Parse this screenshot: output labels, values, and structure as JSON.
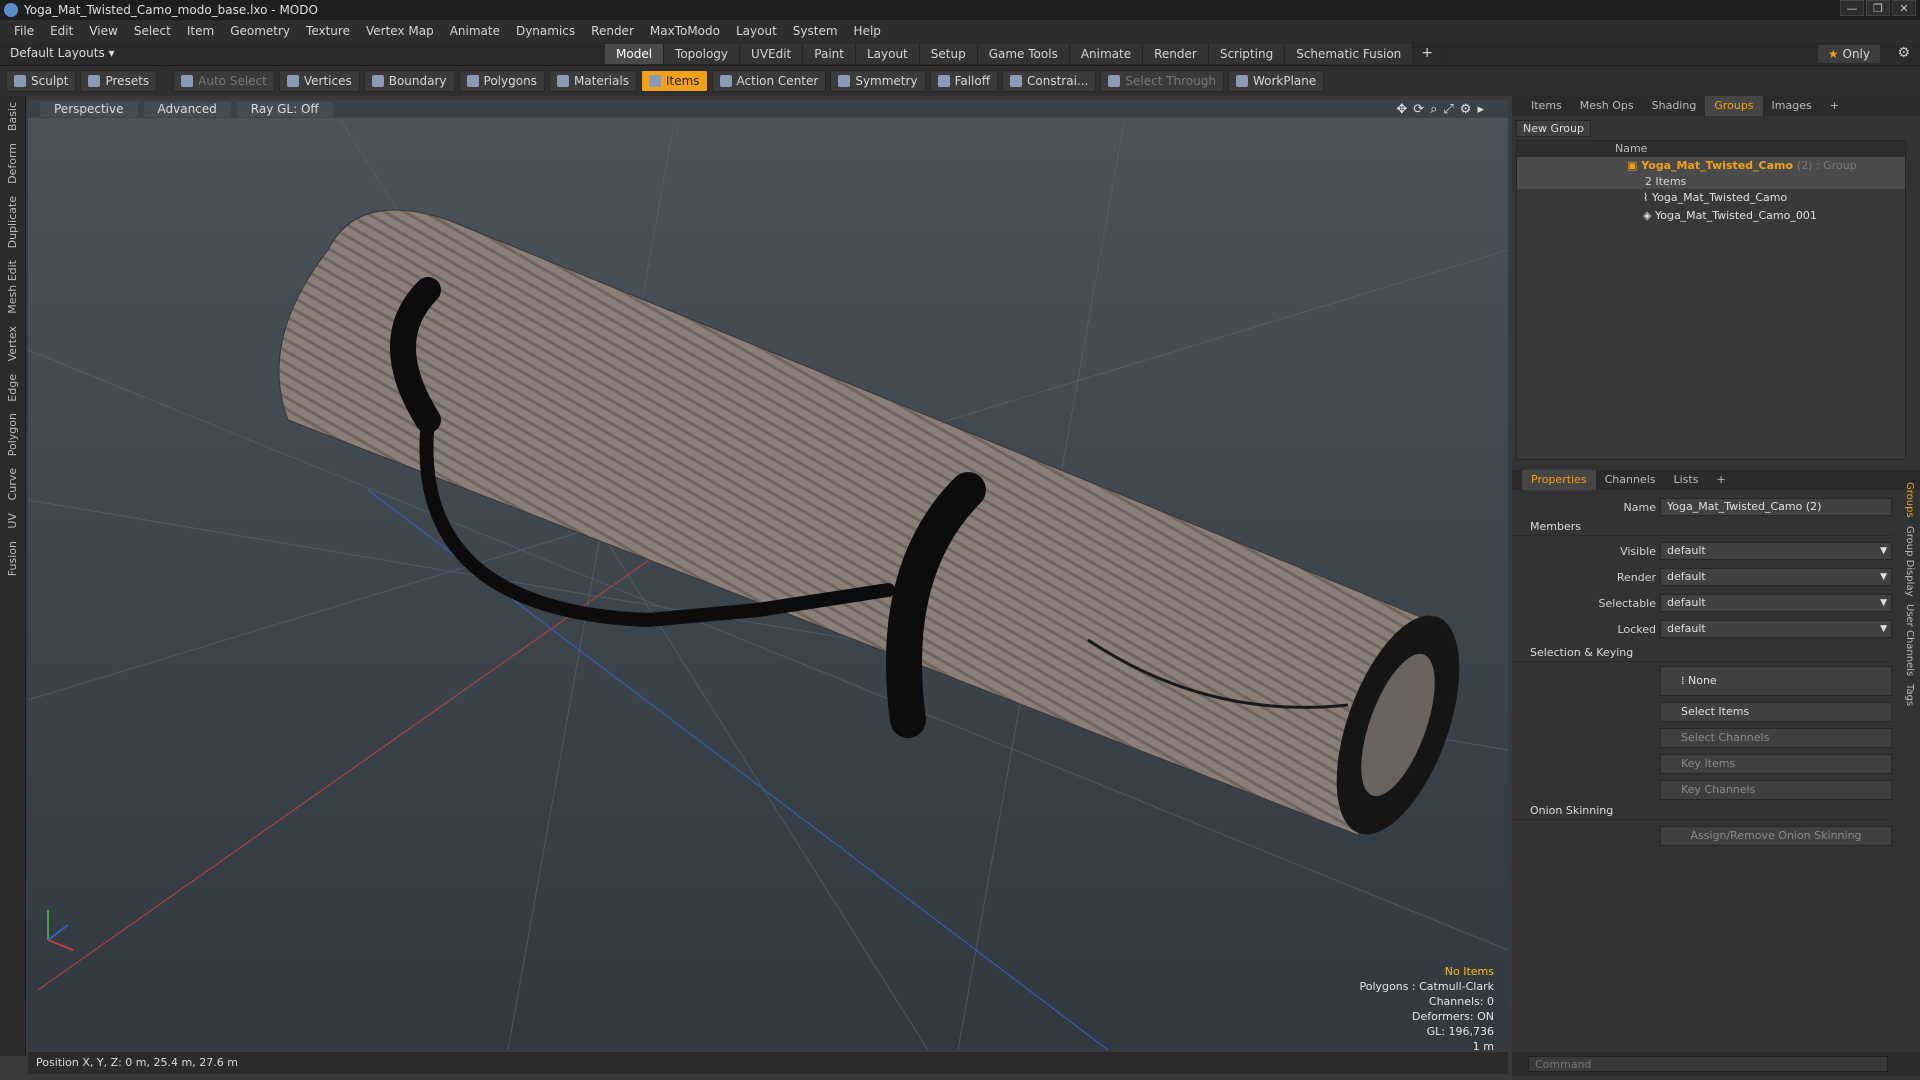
{
  "window": {
    "title": "Yoga_Mat_Twisted_Camo_modo_base.lxo - MODO"
  },
  "menu": [
    "File",
    "Edit",
    "View",
    "Select",
    "Item",
    "Geometry",
    "Texture",
    "Vertex Map",
    "Animate",
    "Dynamics",
    "Render",
    "MaxToModo",
    "Layout",
    "System",
    "Help"
  ],
  "layouts": {
    "label": "Default Layouts ▾"
  },
  "tabs": [
    "Model",
    "Topology",
    "UVEdit",
    "Paint",
    "Layout",
    "Setup",
    "Game Tools",
    "Animate",
    "Render",
    "Scripting",
    "Schematic Fusion"
  ],
  "active_tab": "Model",
  "only": {
    "label": "Only"
  },
  "toolbar": {
    "sculpt": "Sculpt",
    "presets": "Presets",
    "auto_select": "Auto Select",
    "vertices": "Vertices",
    "boundary": "Boundary",
    "polygons": "Polygons",
    "materials": "Materials",
    "items": "Items",
    "action_center": "Action Center",
    "symmetry": "Symmetry",
    "falloff": "Falloff",
    "constrain": "Constrai...",
    "select_through": "Select Through",
    "workplane": "WorkPlane"
  },
  "left_tabs": [
    "Basic",
    "Deform",
    "Duplicate",
    "Mesh Edit",
    "Vertex",
    "Edge",
    "Polygon",
    "Curve",
    "UV",
    "Fusion"
  ],
  "viewport": {
    "view": "Perspective",
    "shading": "Advanced",
    "raygl": "Ray GL: Off",
    "stats": {
      "no_items": "No Items",
      "polygons": "Polygons : Catmull-Clark",
      "channels": "Channels: 0",
      "deformers": "Deformers: ON",
      "gl": "GL: 196,736",
      "scale": "1 m"
    },
    "colors": {
      "mat": "#8a7f78",
      "strap": "#0c0c0c",
      "grid": "#5d6870"
    }
  },
  "status": {
    "position": "Position X, Y, Z:  0 m, 25.4 m, 27.6 m"
  },
  "groups_panel": {
    "tabs": [
      "Items",
      "Mesh Ops",
      "Shading",
      "Groups",
      "Images"
    ],
    "active": "Groups",
    "new_group": "New Group",
    "name_header": "Name",
    "group": {
      "name": "Yoga_Mat_Twisted_Camo",
      "suffix": "(2) : Group",
      "count": "2 Items"
    },
    "children": [
      "Yoga_Mat_Twisted_Camo",
      "Yoga_Mat_Twisted_Camo_001"
    ]
  },
  "properties": {
    "tabs": [
      "Properties",
      "Channels",
      "Lists"
    ],
    "active": "Properties",
    "name_label": "Name",
    "name_value": "Yoga_Mat_Twisted_Camo (2)",
    "members": "Members",
    "fields": [
      {
        "label": "Visible",
        "value": "default"
      },
      {
        "label": "Render",
        "value": "default"
      },
      {
        "label": "Selectable",
        "value": "default"
      },
      {
        "label": "Locked",
        "value": "default"
      }
    ],
    "sel_keying": "Selection & Keying",
    "none": "None",
    "select_items": "Select Items",
    "select_channels": "Select Channels",
    "key_items": "Key Items",
    "key_channels": "Key Channels",
    "onion": "Onion Skinning",
    "onion_btn": "Assign/Remove Onion Skinning",
    "side_tabs": [
      "Groups",
      "Group Display",
      "User Channels",
      "Tags"
    ]
  },
  "command": {
    "placeholder": "Command"
  }
}
